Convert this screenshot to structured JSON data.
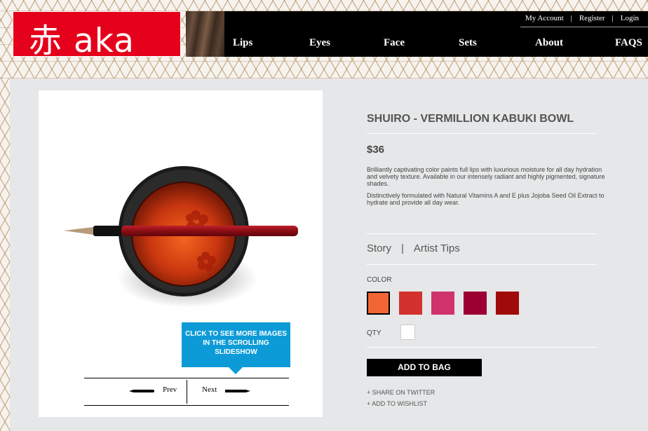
{
  "header": {
    "logo_text": "赤 aka",
    "utility_links": [
      "My Account",
      "Register",
      "Login"
    ],
    "nav": [
      {
        "label": "Lips"
      },
      {
        "label": "Eyes"
      },
      {
        "label": "Face"
      },
      {
        "label": "Sets"
      },
      {
        "label": "About"
      },
      {
        "label": "FAQS"
      }
    ]
  },
  "gallery": {
    "tooltip": "CLICK TO SEE MORE IMAGES IN THE SCROLLING SLIDESHOW",
    "prev_label": "Prev",
    "next_label": "Next"
  },
  "product": {
    "title": "SHUIRO - VERMILLION KABUKI BOWL",
    "price": "$36",
    "description_1": "Brilliantly captivating color paints full lips with luxurious moisture for all day hydration and velvety texture. Available in our intensely radiant and highly pigmented, signature shades.",
    "description_2": "Distinctively formulated with Natural Vitamins A and E plus Jojoba Seed Oil Extract to hydrate and provide all day wear.",
    "tabs": [
      "Story",
      "Artist Tips"
    ],
    "tab_separator": "|",
    "color_label": "COLOR",
    "swatches": [
      {
        "color": "#f26535",
        "selected": true
      },
      {
        "color": "#d3312e",
        "selected": false
      },
      {
        "color": "#d0336a",
        "selected": false
      },
      {
        "color": "#9c0033",
        "selected": false
      },
      {
        "color": "#a10a0a",
        "selected": false
      }
    ],
    "qty_label": "QTY",
    "add_to_bag": "ADD TO BAG",
    "share_twitter": "+ SHARE ON TWITTER",
    "add_wishlist": "+ ADD TO WISHLIST"
  },
  "colors": {
    "brand_red": "#e5001b",
    "tooltip_blue": "#0d9bd7",
    "page_bg": "#e6e7e8"
  }
}
